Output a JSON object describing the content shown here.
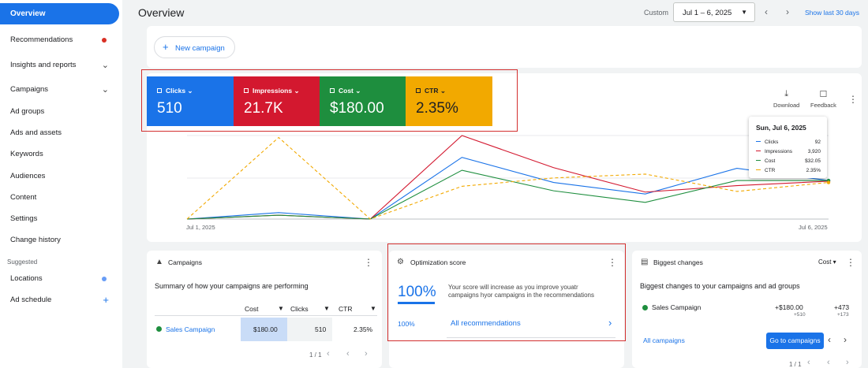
{
  "sidebar": {
    "active": "Overview",
    "items": [
      {
        "label": "Recommendations",
        "marker": "dot-red"
      },
      {
        "label": "Insights and reports",
        "marker": "chevron"
      },
      {
        "label": "Campaigns",
        "marker": "chevron"
      },
      {
        "label": "Ad groups"
      },
      {
        "label": "Ads and assets"
      },
      {
        "label": "Keywords"
      },
      {
        "label": "Audiences"
      },
      {
        "label": "Content"
      },
      {
        "label": "Settings"
      },
      {
        "label": "Change history"
      }
    ],
    "suggested_label": "Suggested",
    "suggested": [
      {
        "label": "Locations",
        "marker": "dot-blue"
      },
      {
        "label": "Ad schedule",
        "marker": "plus"
      }
    ]
  },
  "header": {
    "title": "Overview",
    "range_type": "Custom",
    "date_range": "Jul 1 – 6, 2025",
    "show_last_link": "Show last 30 days"
  },
  "new_campaign_label": "New campaign",
  "metrics": [
    {
      "label": "Clicks",
      "value": "510",
      "color": "#1a73e8"
    },
    {
      "label": "Impressions",
      "value": "21.7K",
      "color": "#d3182f"
    },
    {
      "label": "Cost",
      "value": "$180.00",
      "color": "#1e8e3e"
    },
    {
      "label": "CTR",
      "value": "2.35%",
      "color": "#f2a900"
    }
  ],
  "chart_tools": {
    "download": "Download",
    "feedback": "Feedback"
  },
  "tooltip": {
    "date": "Sun, Jul 6, 2025",
    "rows": [
      {
        "label": "Clicks",
        "value": "92",
        "color": "#1a73e8"
      },
      {
        "label": "Impressions",
        "value": "3,920",
        "color": "#d3182f"
      },
      {
        "label": "Cost",
        "value": "$32.05",
        "color": "#1e8e3e"
      },
      {
        "label": "CTR",
        "value": "2.35%",
        "color": "#f2a900"
      }
    ]
  },
  "chart_data": {
    "type": "line",
    "x_tick_labels": [
      "Jul 1, 2025",
      "Jul 6, 2025"
    ],
    "x": [
      0,
      1,
      2,
      3,
      4,
      5,
      6,
      7
    ],
    "series": [
      {
        "name": "Clicks",
        "color": "#1a73e8",
        "values": [
          0,
          0.1,
          0,
          0.96,
          0.57,
          0.39,
          0.79,
          0.6
        ]
      },
      {
        "name": "Impressions",
        "color": "#d3182f",
        "values": [
          0,
          0.06,
          0,
          1.3,
          0.8,
          0.42,
          0.52,
          0.59
        ]
      },
      {
        "name": "Cost",
        "color": "#1e8e3e",
        "values": [
          0,
          0.06,
          0,
          0.76,
          0.44,
          0.26,
          0.6,
          0.6
        ]
      },
      {
        "name": "CTR",
        "color": "#f2a900",
        "values": [
          0,
          1.27,
          0,
          0.51,
          0.64,
          0.7,
          0.43,
          0.57
        ],
        "dashed": true
      }
    ]
  },
  "campaigns_card": {
    "title": "Campaigns",
    "summary": "Summary of how your campaigns are performing",
    "columns": [
      "Cost",
      "Clicks",
      "CTR"
    ],
    "row": {
      "name": "Sales Campaign",
      "cost": "$180.00",
      "clicks": "510",
      "ctr": "2.35%"
    },
    "pagination": "1 / 1"
  },
  "optimization_card": {
    "title": "Optimization score",
    "score": "100%",
    "description": "Your score will increase as you improve youatr campaigns hyor campaigns in the recommendations",
    "footer_score": "100%",
    "link": "All recommendations"
  },
  "changes_card": {
    "title": "Biggest changes",
    "sort_label": "Cost",
    "subtitle": "Biggest changes to your campaigns and ad groups",
    "row": {
      "name": "Sales Campaign",
      "cost_change": "+$180.00",
      "cost_sub": "+510",
      "clicks_change": "+473",
      "clicks_sub": "+173"
    },
    "all_link": "All campaigns",
    "go_button": "Go to campaigns",
    "pagination": "1 / 1"
  }
}
